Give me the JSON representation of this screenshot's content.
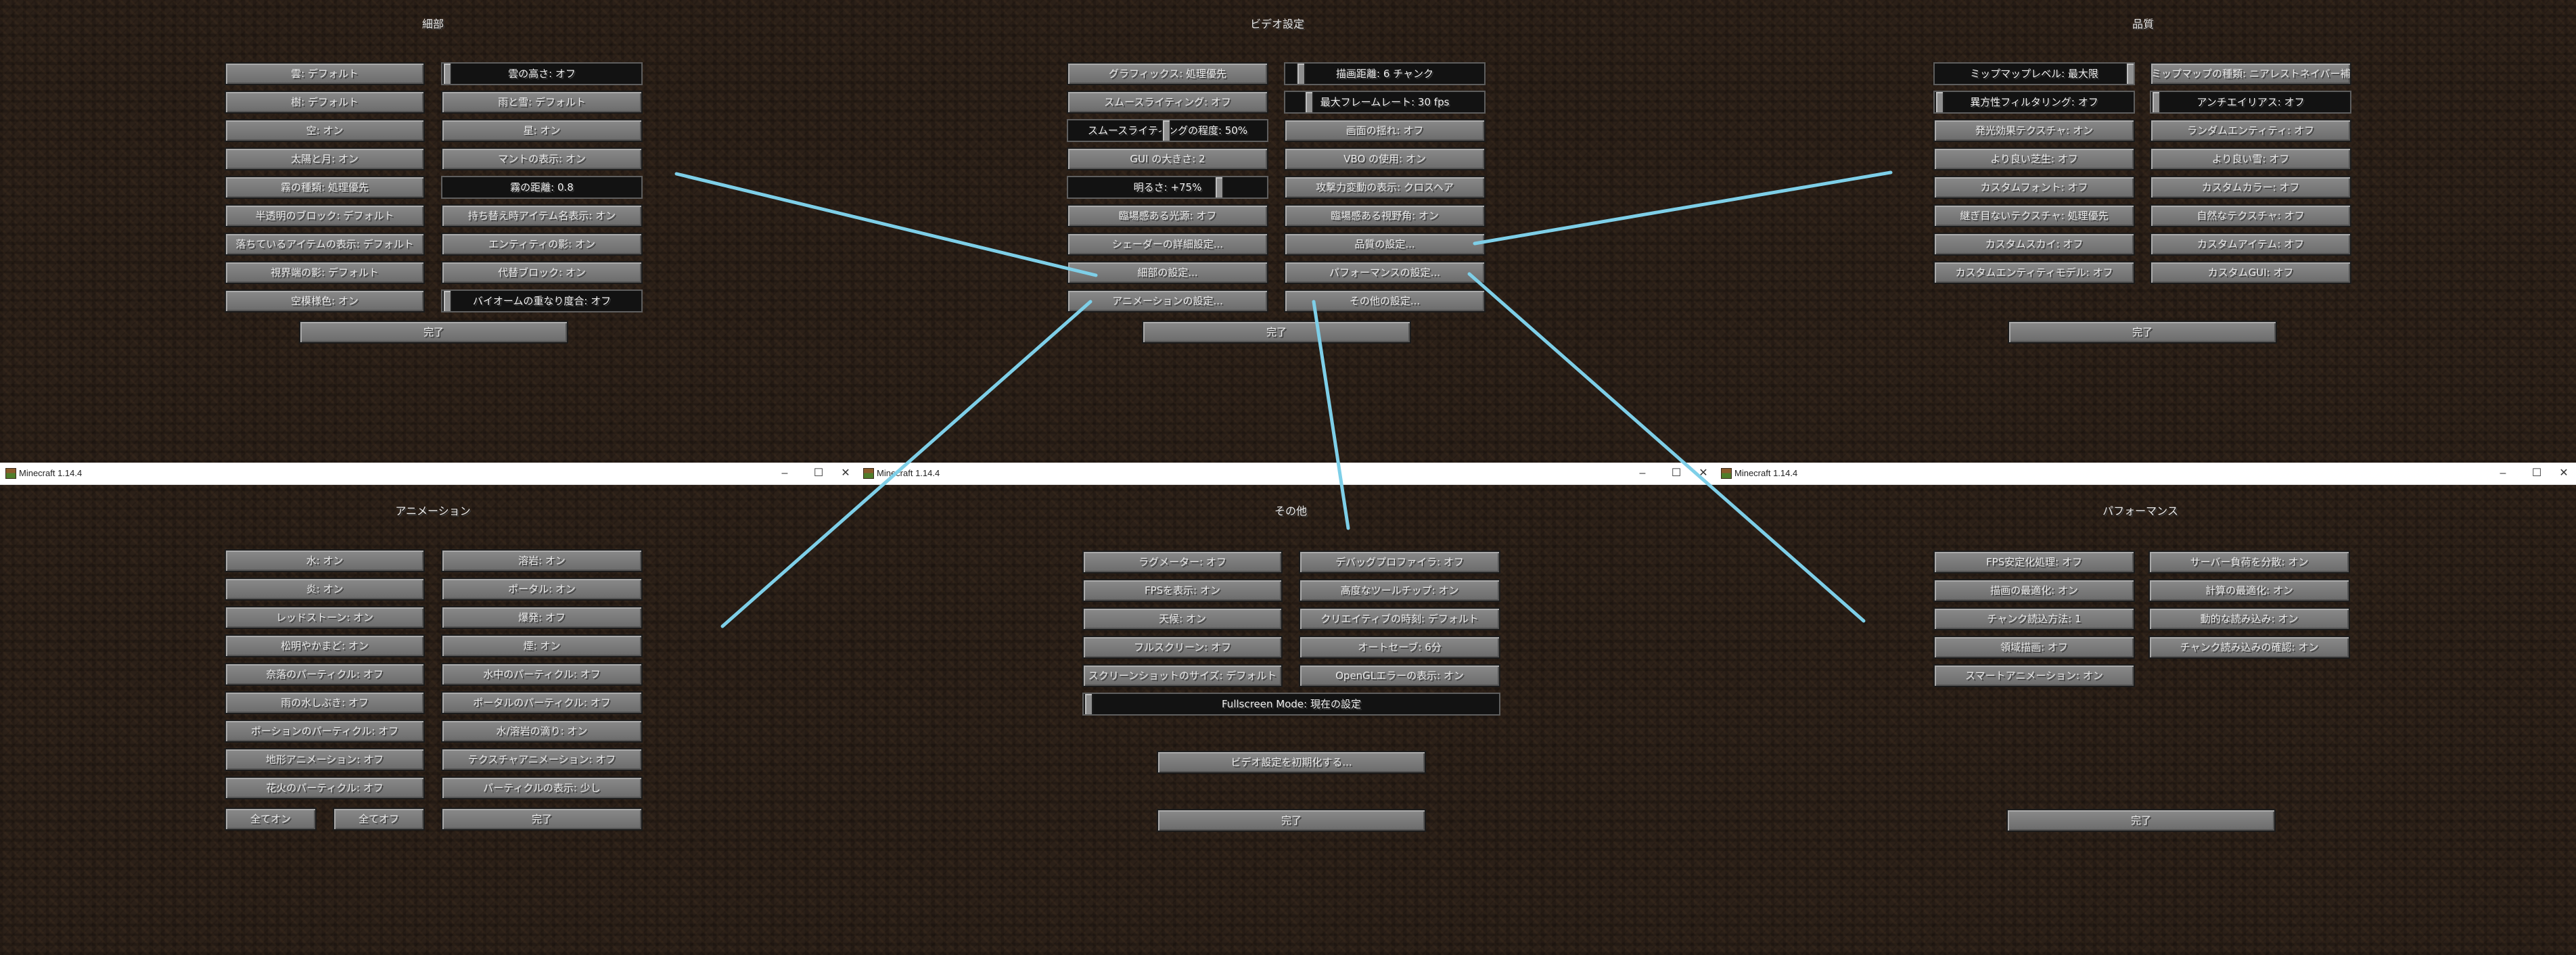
{
  "window_title": "Minecraft 1.14.4",
  "window_controls": {
    "minimize": "–",
    "maximize": "☐",
    "close": "✕"
  },
  "details": {
    "title": "細部",
    "buttons": [
      "雲: デフォルト",
      "雲の高さ: オフ",
      "樹: デフォルト",
      "雨と雪: デフォルト",
      "空: オン",
      "星: オン",
      "太陽と月: オン",
      "マントの表示: オン",
      "霧の種類: 処理優先",
      "霧の距離: 0.8",
      "半透明のブロック: デフォルト",
      "持ち替え時アイテム名表示: オン",
      "落ちているアイテムの表示: デフォルト",
      "エンティティの影: オン",
      "視界端の影: デフォルト",
      "代替ブロック: オン",
      "空模様色: オン",
      "バイオームの重なり度合: オフ"
    ],
    "done": "完了"
  },
  "video": {
    "title": "ビデオ設定",
    "buttons": [
      "グラフィックス: 処理優先",
      "描画距離: 6 チャンク",
      "スムースライティング: オフ",
      "最大フレームレート: 30 fps",
      "スムースライティングの程度: 50%",
      "画面の揺れ: オフ",
      "GUI の大きさ: 2",
      "VBO の使用: オン",
      "明るさ: +75%",
      "攻撃力変動の表示: クロスヘア",
      "臨場感ある光源: オフ",
      "臨場感ある視野角: オン",
      "シェーダーの詳細設定...",
      "品質の設定...",
      "細部の設定...",
      "パフォーマンスの設定...",
      "アニメーションの設定...",
      "その他の設定..."
    ],
    "done": "完了"
  },
  "quality": {
    "title": "品質",
    "buttons": [
      "ミップマップレベル: 最大限",
      "ミップマップの種類: ニアレストネイバー補間",
      "異方性フィルタリング: オフ",
      "アンチエイリアス: オフ",
      "発光効果テクスチャ: オン",
      "ランダムエンティティ: オフ",
      "より良い芝生: オフ",
      "より良い雪: オフ",
      "カスタムフォント: オフ",
      "カスタムカラー: オフ",
      "継ぎ目ないテクスチャ: 処理優先",
      "自然なテクスチャ: オフ",
      "カスタムスカイ: オフ",
      "カスタムアイテム: オフ",
      "カスタムエンティティモデル: オフ",
      "カスタムGUI: オフ"
    ],
    "done": "完了"
  },
  "animation": {
    "title": "アニメーション",
    "buttons": [
      "水: オン",
      "溶岩: オン",
      "炎: オン",
      "ポータル: オン",
      "レッドストーン: オン",
      "爆発: オフ",
      "松明やかまど: オン",
      "煙: オン",
      "奈落のパーティクル: オフ",
      "水中のパーティクル: オフ",
      "雨の水しぶき: オフ",
      "ポータルのパーティクル: オフ",
      "ポーションのパーティクル: オフ",
      "水/溶岩の滴り: オン",
      "地形アニメーション: オフ",
      "テクスチャアニメーション: オフ",
      "花火のパーティクル: オフ",
      "パーティクルの表示: 少し"
    ],
    "all_on": "全てオン",
    "all_off": "全てオフ",
    "done": "完了"
  },
  "other": {
    "title": "その他",
    "buttons": [
      "ラグメーター: オフ",
      "デバッグプロファイラ: オフ",
      "FPSを表示: オン",
      "高度なツールチップ: オン",
      "天候: オン",
      "クリエイティブの時刻: デフォルト",
      "フルスクリーン: オフ",
      "オートセーブ: 6分",
      "スクリーンショットのサイズ: デフォルト",
      "OpenGLエラーの表示: オン"
    ],
    "fullscreen_mode": "Fullscreen Mode: 現在の設定",
    "reset": "ビデオ設定を初期化する...",
    "done": "完了"
  },
  "performance": {
    "title": "パフォーマンス",
    "buttons": [
      "FPS安定化処理: オフ",
      "サーバー負荷を分散: オン",
      "描画の最適化: オン",
      "計算の最適化: オン",
      "チャンク読込方法: 1",
      "動的な読み込み: オン",
      "領域描画: オフ",
      "チャンク読み込みの確認: オン",
      "スマートアニメーション: オン"
    ],
    "done": "完了"
  },
  "colors": {
    "connector": "#7ecfe8",
    "button_face": "#7a7a7a",
    "slider_bg": "#121212",
    "text": "#e8e8e8"
  }
}
